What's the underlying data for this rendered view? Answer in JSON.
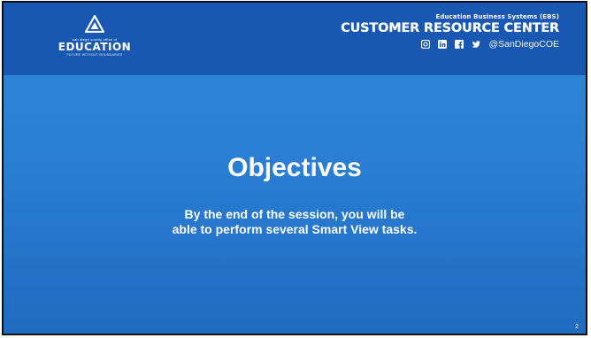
{
  "header": {
    "logo": {
      "org_small": "san diego county office of",
      "org_big": "EDUCATION",
      "tagline": "FUTURE WITHOUT BOUNDARIES"
    },
    "crc_subtitle": "Education Business Systems (EBS)",
    "crc_title": "CUSTOMER RESOURCE CENTER",
    "social_icons": [
      "instagram-icon",
      "linkedin-icon",
      "facebook-icon",
      "twitter-icon"
    ],
    "handle": "@SanDiegoCOE"
  },
  "slide": {
    "title": "Objectives",
    "body_line1": "By the end of the session, you will be",
    "body_line2": "able to perform several Smart View tasks.",
    "page_number": "2"
  },
  "colors": {
    "header_bg": "#1858b2",
    "slide_bg": "#2a7fd4",
    "text": "#ffffff"
  }
}
